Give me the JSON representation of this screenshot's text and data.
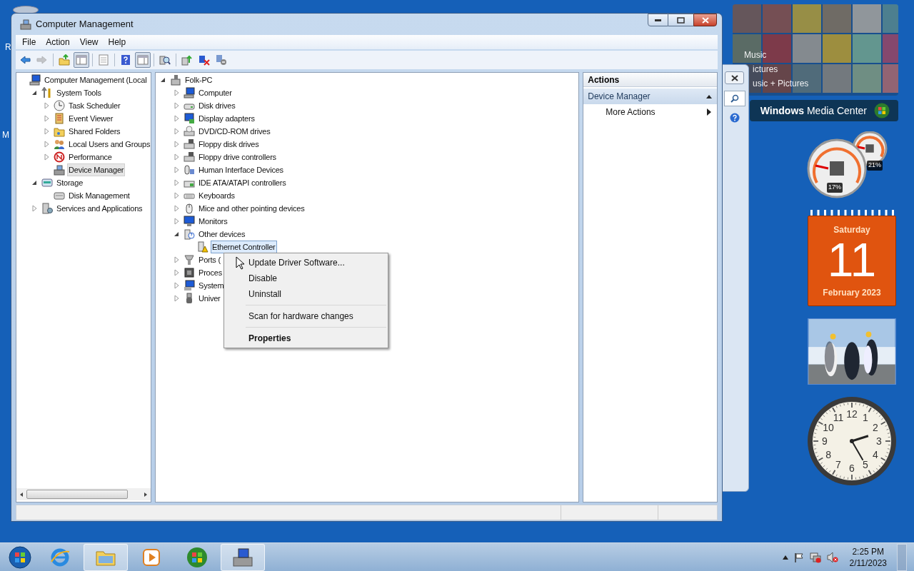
{
  "desktop_icons": [
    {
      "label": "R"
    },
    {
      "label": "M"
    }
  ],
  "window": {
    "title": "Computer Management",
    "menu": [
      "File",
      "Action",
      "View",
      "Help"
    ],
    "toolbar": [
      {
        "pressed": false,
        "disabled": false
      },
      {
        "pressed": false,
        "disabled": true
      },
      {
        "pressed": false,
        "disabled": false
      },
      {
        "pressed": true,
        "disabled": false
      },
      {
        "pressed": false,
        "disabled": false
      },
      {
        "pressed": false,
        "disabled": false
      },
      {
        "pressed": true,
        "disabled": false
      },
      {
        "pressed": false,
        "disabled": false
      },
      {
        "pressed": false,
        "disabled": false
      },
      {
        "pressed": false,
        "disabled": false
      },
      {
        "pressed": false,
        "disabled": false
      }
    ]
  },
  "console_tree": [
    {
      "label": "Computer Management (Local",
      "selected": false,
      "children": [
        {
          "label": "System Tools",
          "selected": false,
          "expanded": true,
          "children": [
            {
              "label": "Task Scheduler",
              "selected": false,
              "expanded": false
            },
            {
              "label": "Event Viewer",
              "selected": false,
              "expanded": false
            },
            {
              "label": "Shared Folders",
              "selected": false,
              "expanded": false
            },
            {
              "label": "Local Users and Groups",
              "selected": false,
              "expanded": false
            },
            {
              "label": "Performance",
              "selected": false,
              "expanded": false
            },
            {
              "label": "Device Manager",
              "selected": true
            }
          ]
        },
        {
          "label": "Storage",
          "selected": false,
          "expanded": true,
          "children": [
            {
              "label": "Disk Management",
              "selected": false
            }
          ]
        },
        {
          "label": "Services and Applications",
          "selected": false,
          "expanded": false
        }
      ]
    }
  ],
  "device_tree": [
    {
      "label": "Folk-PC",
      "selected": false,
      "expanded": true,
      "children": [
        {
          "label": "Computer",
          "selected": false,
          "expanded": false
        },
        {
          "label": "Disk drives",
          "selected": false,
          "expanded": false
        },
        {
          "label": "Display adapters",
          "selected": false,
          "expanded": false
        },
        {
          "label": "DVD/CD-ROM drives",
          "selected": false,
          "expanded": false
        },
        {
          "label": "Floppy disk drives",
          "selected": false,
          "expanded": false
        },
        {
          "label": "Floppy drive controllers",
          "selected": false,
          "expanded": false
        },
        {
          "label": "Human Interface Devices",
          "selected": false,
          "expanded": false
        },
        {
          "label": "IDE ATA/ATAPI controllers",
          "selected": false,
          "expanded": false
        },
        {
          "label": "Keyboards",
          "selected": false,
          "expanded": false
        },
        {
          "label": "Mice and other pointing devices",
          "selected": false,
          "expanded": false
        },
        {
          "label": "Monitors",
          "selected": false,
          "expanded": false
        },
        {
          "label": "Other devices",
          "selected": false,
          "expanded": true,
          "children": [
            {
              "label": "Ethernet Controller",
              "selected": true
            }
          ]
        },
        {
          "label": "Ports (",
          "selected": false,
          "expanded": false
        },
        {
          "label": "Proces",
          "selected": false,
          "expanded": false
        },
        {
          "label": "System",
          "selected": false,
          "expanded": false
        },
        {
          "label": "Univer",
          "selected": false,
          "expanded": false
        }
      ]
    }
  ],
  "actions": {
    "title": "Actions",
    "sections": [
      {
        "label": "Device Manager",
        "expanded": true,
        "items": [
          {
            "label": "More Actions",
            "has_submenu": true
          }
        ]
      }
    ]
  },
  "context_menu": [
    {
      "kind": "item",
      "label": "Update Driver Software...",
      "default": false
    },
    {
      "kind": "item",
      "label": "Disable",
      "default": false
    },
    {
      "kind": "item",
      "label": "Uninstall",
      "default": false
    },
    {
      "kind": "separator"
    },
    {
      "kind": "item",
      "label": "Scan for hardware changes",
      "default": false
    },
    {
      "kind": "separator"
    },
    {
      "kind": "item",
      "label": "Properties",
      "default": true
    }
  ],
  "media_center": {
    "labels": [
      "Music",
      "ictures",
      "usic + Pictures"
    ],
    "brand": "**Windows** Media Center"
  },
  "cpu_meter": {
    "readings": [
      "17%",
      "21%"
    ]
  },
  "calendar": {
    "weekday": "Saturday",
    "day": "11",
    "month_year": "February 2023"
  },
  "clock": {
    "numerals": [
      "12",
      "11",
      "1",
      "10",
      "2",
      "9",
      "3",
      "8",
      "4",
      "7",
      "5",
      "6"
    ]
  },
  "taskbar": {
    "buttons": [
      {
        "active": false
      },
      {
        "active": false
      },
      {
        "active": true
      },
      {
        "active": false
      },
      {
        "active": false
      },
      {
        "active": true
      }
    ],
    "time": "2:25 PM",
    "date": "2/11/2023"
  }
}
